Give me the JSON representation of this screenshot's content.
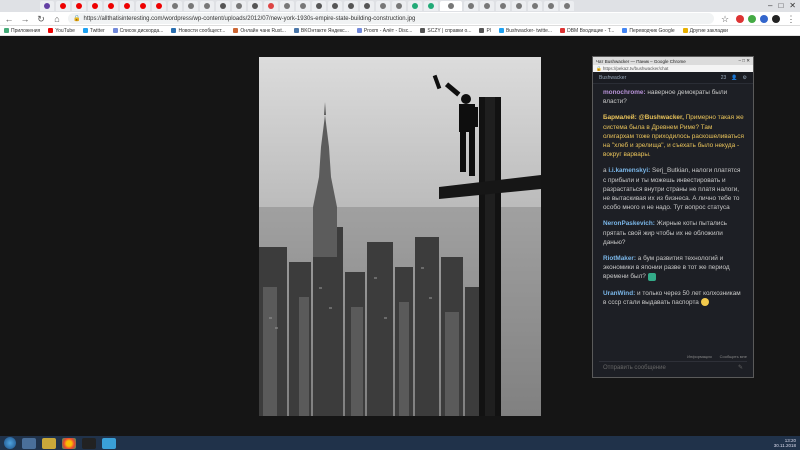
{
  "browser": {
    "url": "https://allthatisinteresting.com/wordpress/wp-content/uploads/2012/07/new-york-1930s-empire-state-building-construction.jpg",
    "url_domain": "allthatisinteresting.com",
    "window_controls": [
      "–",
      "□",
      "✕"
    ]
  },
  "bookmarks": [
    "Приложения",
    "YouTube",
    "Twitter",
    "Список дискорда...",
    "Новости сообщест...",
    "Онлайн чанк Rust...",
    "BKOнтакте Яндекс...",
    "Proxm - Алёт - Disc...",
    "SCZY | справки о...",
    "Pl",
    "Bushwacker- twitte...",
    "DBM Входящие - Т...",
    "Переводчик Google",
    "Другие закладки"
  ],
  "chat": {
    "window_title": "Чат Bushwacker — Паник – Google Chrome",
    "url": "https://peka2.tv/bushwacker/chat",
    "channel": "Bushwacker",
    "viewers": "23",
    "messages": [
      {
        "author": "monochrome:",
        "author_color": "#b893d8",
        "text": " наверное демократы были власти?",
        "highlight": false
      },
      {
        "author": "Бармалей:",
        "author_color": "#e9c35a",
        "mention": "@Bushwacker,",
        "text": " Примерно такая же система была в Древнем Риме? Там олигархам тоже приходилось раскошеливаться на \"хлеб и зрелища\", и съехать было некуда - вокруг варвары.",
        "highlight": true
      },
      {
        "author": "i.i.kamenskyi:",
        "author_color": "#7ab6e8",
        "prefix": "a ",
        "text": " Serj_Butkian, налоги платятся с прибыли и ты можешь инвестировать и разрастаться внутри страны не платя налоги, не вытаскивая их из бизнеса. А лично тебе то особо много и не надо. Тут вопрос статуса",
        "highlight": false
      },
      {
        "author": "NeronPaskevich:",
        "author_color": "#7ab6e8",
        "text": " Жирные коты пытались прятать свой жир чтобы их не обложили данью?",
        "highlight": false
      },
      {
        "author": "RiotMaker:",
        "author_color": "#7ab6e8",
        "text": " а бум развития технологий и экономики в японии разве в тот же период времени был?",
        "highlight": false
      },
      {
        "author": "UranWind:",
        "author_color": "#7ab6e8",
        "text": " и только через 50 лет колхозникам в ссср стали выдавать паспорта",
        "highlight": false
      }
    ],
    "footer_links": [
      "Информация",
      "Сообщить мне"
    ],
    "input_placeholder": "Отправить сообщение"
  },
  "taskbar": {
    "time": "13:20",
    "date": "30.11.2018"
  },
  "colors": {
    "page_bg": "#151515",
    "chat_bg": "#1d1f25",
    "taskbar": "#20324a",
    "highlight": "#e9c35a"
  }
}
